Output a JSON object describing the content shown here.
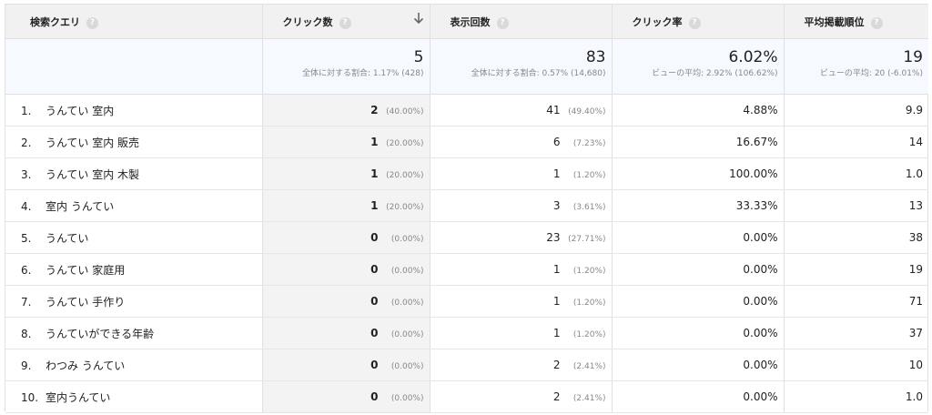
{
  "columns": {
    "query": "検索クエリ",
    "clicks": "クリック数",
    "impressions": "表示回数",
    "ctr": "クリック率",
    "rank": "平均掲載順位"
  },
  "help_glyph": "?",
  "summary": {
    "clicks": {
      "value": "5",
      "sub": "全体に対する割合: 1.17% (428)"
    },
    "impressions": {
      "value": "83",
      "sub": "全体に対する割合: 0.57% (14,680)"
    },
    "ctr": {
      "value": "6.02%",
      "sub": "ビューの平均: 2.92% (106.62%)"
    },
    "rank": {
      "value": "19",
      "sub": "ビューの平均: 20 (-6.01%)"
    }
  },
  "rows": [
    {
      "index": "1.",
      "query": "うんてい 室内",
      "clicks": "2",
      "clicks_pct": "(40.00%)",
      "impressions": "41",
      "impressions_pct": "(49.40%)",
      "ctr": "4.88%",
      "rank": "9.9"
    },
    {
      "index": "2.",
      "query": "うんてい 室内 販売",
      "clicks": "1",
      "clicks_pct": "(20.00%)",
      "impressions": "6",
      "impressions_pct": "(7.23%)",
      "ctr": "16.67%",
      "rank": "14"
    },
    {
      "index": "3.",
      "query": "うんてい 室内 木製",
      "clicks": "1",
      "clicks_pct": "(20.00%)",
      "impressions": "1",
      "impressions_pct": "(1.20%)",
      "ctr": "100.00%",
      "rank": "1.0"
    },
    {
      "index": "4.",
      "query": "室内 うんてい",
      "clicks": "1",
      "clicks_pct": "(20.00%)",
      "impressions": "3",
      "impressions_pct": "(3.61%)",
      "ctr": "33.33%",
      "rank": "13"
    },
    {
      "index": "5.",
      "query": "うんてい",
      "clicks": "0",
      "clicks_pct": "(0.00%)",
      "impressions": "23",
      "impressions_pct": "(27.71%)",
      "ctr": "0.00%",
      "rank": "38"
    },
    {
      "index": "6.",
      "query": "うんてい 家庭用",
      "clicks": "0",
      "clicks_pct": "(0.00%)",
      "impressions": "1",
      "impressions_pct": "(1.20%)",
      "ctr": "0.00%",
      "rank": "19"
    },
    {
      "index": "7.",
      "query": "うんてい 手作り",
      "clicks": "0",
      "clicks_pct": "(0.00%)",
      "impressions": "1",
      "impressions_pct": "(1.20%)",
      "ctr": "0.00%",
      "rank": "71"
    },
    {
      "index": "8.",
      "query": "うんていができる年齢",
      "clicks": "0",
      "clicks_pct": "(0.00%)",
      "impressions": "1",
      "impressions_pct": "(1.20%)",
      "ctr": "0.00%",
      "rank": "37"
    },
    {
      "index": "9.",
      "query": "わつみ うんてい",
      "clicks": "0",
      "clicks_pct": "(0.00%)",
      "impressions": "2",
      "impressions_pct": "(2.41%)",
      "ctr": "0.00%",
      "rank": "10"
    },
    {
      "index": "10.",
      "query": "室内うんてい",
      "clicks": "0",
      "clicks_pct": "(0.00%)",
      "impressions": "2",
      "impressions_pct": "(2.41%)",
      "ctr": "0.00%",
      "rank": "1.0"
    }
  ]
}
